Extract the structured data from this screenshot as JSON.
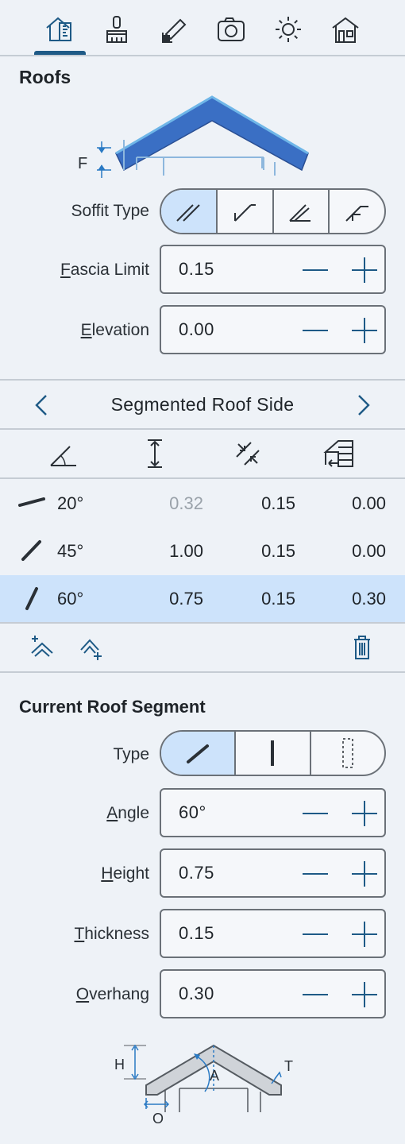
{
  "toolbar": {
    "tabs": [
      {
        "icon": "measure-house-icon",
        "active": true
      },
      {
        "icon": "paint-brush-icon",
        "active": false
      },
      {
        "icon": "pencil-ruler-icon",
        "active": false
      },
      {
        "icon": "camera-icon",
        "active": false
      },
      {
        "icon": "sun-icon",
        "active": false
      },
      {
        "icon": "house-icon",
        "active": false
      }
    ]
  },
  "roofs": {
    "title": "Roofs",
    "diagram_label": "F",
    "soffit_type": {
      "label": "Soffit Type",
      "selected_index": 0,
      "option_count": 4
    },
    "fascia_limit": {
      "label_first": "F",
      "label_rest": "ascia Limit",
      "value": "0.15"
    },
    "elevation": {
      "label_first": "E",
      "label_rest": "levation",
      "value": "0.00"
    }
  },
  "side_nav": {
    "title": "Segmented Roof Side",
    "prev_icon": "chevron-left-icon",
    "next_icon": "chevron-right-icon"
  },
  "segments_table": {
    "column_icons": [
      "angle-icon",
      "height-icon",
      "thickness-icon",
      "overhang-icon"
    ],
    "rows": [
      {
        "angle": "20°",
        "height": "0.32",
        "thickness": "0.15",
        "overhang": "0.00",
        "height_muted": true,
        "selected": false
      },
      {
        "angle": "45°",
        "height": "1.00",
        "thickness": "0.15",
        "overhang": "0.00",
        "height_muted": false,
        "selected": false
      },
      {
        "angle": "60°",
        "height": "0.75",
        "thickness": "0.15",
        "overhang": "0.30",
        "height_muted": false,
        "selected": true
      }
    ],
    "actions": [
      "add-segment-above-icon",
      "add-segment-below-icon",
      "trash-icon"
    ]
  },
  "current_segment": {
    "title": "Current Roof Segment",
    "type": {
      "label": "Type",
      "selected_index": 0
    },
    "angle": {
      "label_first": "A",
      "label_rest": "ngle",
      "value": "60°"
    },
    "height": {
      "label_first": "H",
      "label_rest": "eight",
      "value": "0.75"
    },
    "thickness": {
      "label_first": "T",
      "label_rest": "hickness",
      "value": "0.15"
    },
    "overhang": {
      "label_first": "O",
      "label_rest": "verhang",
      "value": "0.30"
    },
    "diagram_labels": {
      "h": "H",
      "a": "A",
      "t": "T",
      "o": "O"
    }
  },
  "colors": {
    "accent": "#1e5a86",
    "selected_bg": "#cde3fb",
    "roof_blue": "#3a6fc4",
    "panel_bg": "#eef2f7"
  }
}
